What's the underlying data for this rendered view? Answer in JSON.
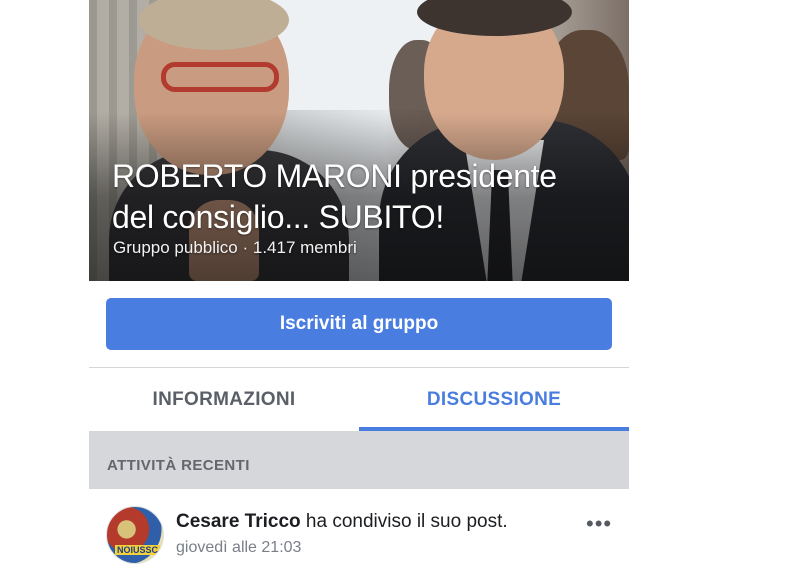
{
  "group": {
    "title": "ROBERTO MARONI presidente del consiglio... SUBITO!",
    "meta": "Gruppo pubblico · 1.417 membri"
  },
  "join_button": {
    "label": "Iscriviti al gruppo"
  },
  "tabs": [
    {
      "label": "INFORMAZIONI",
      "active": false
    },
    {
      "label": "DISCUSSIONE",
      "active": true
    }
  ],
  "section": {
    "header": "ATTIVITÀ RECENTI"
  },
  "post": {
    "author": "Cesare Tricco",
    "action": " ha condiviso il suo post.",
    "time": "giovedì alle 21:03",
    "avatar_text": "NOIUSSC",
    "more_icon": "more-horizontal-icon"
  },
  "colors": {
    "accent": "#4a7de0",
    "section_bg": "#d6d7da"
  }
}
